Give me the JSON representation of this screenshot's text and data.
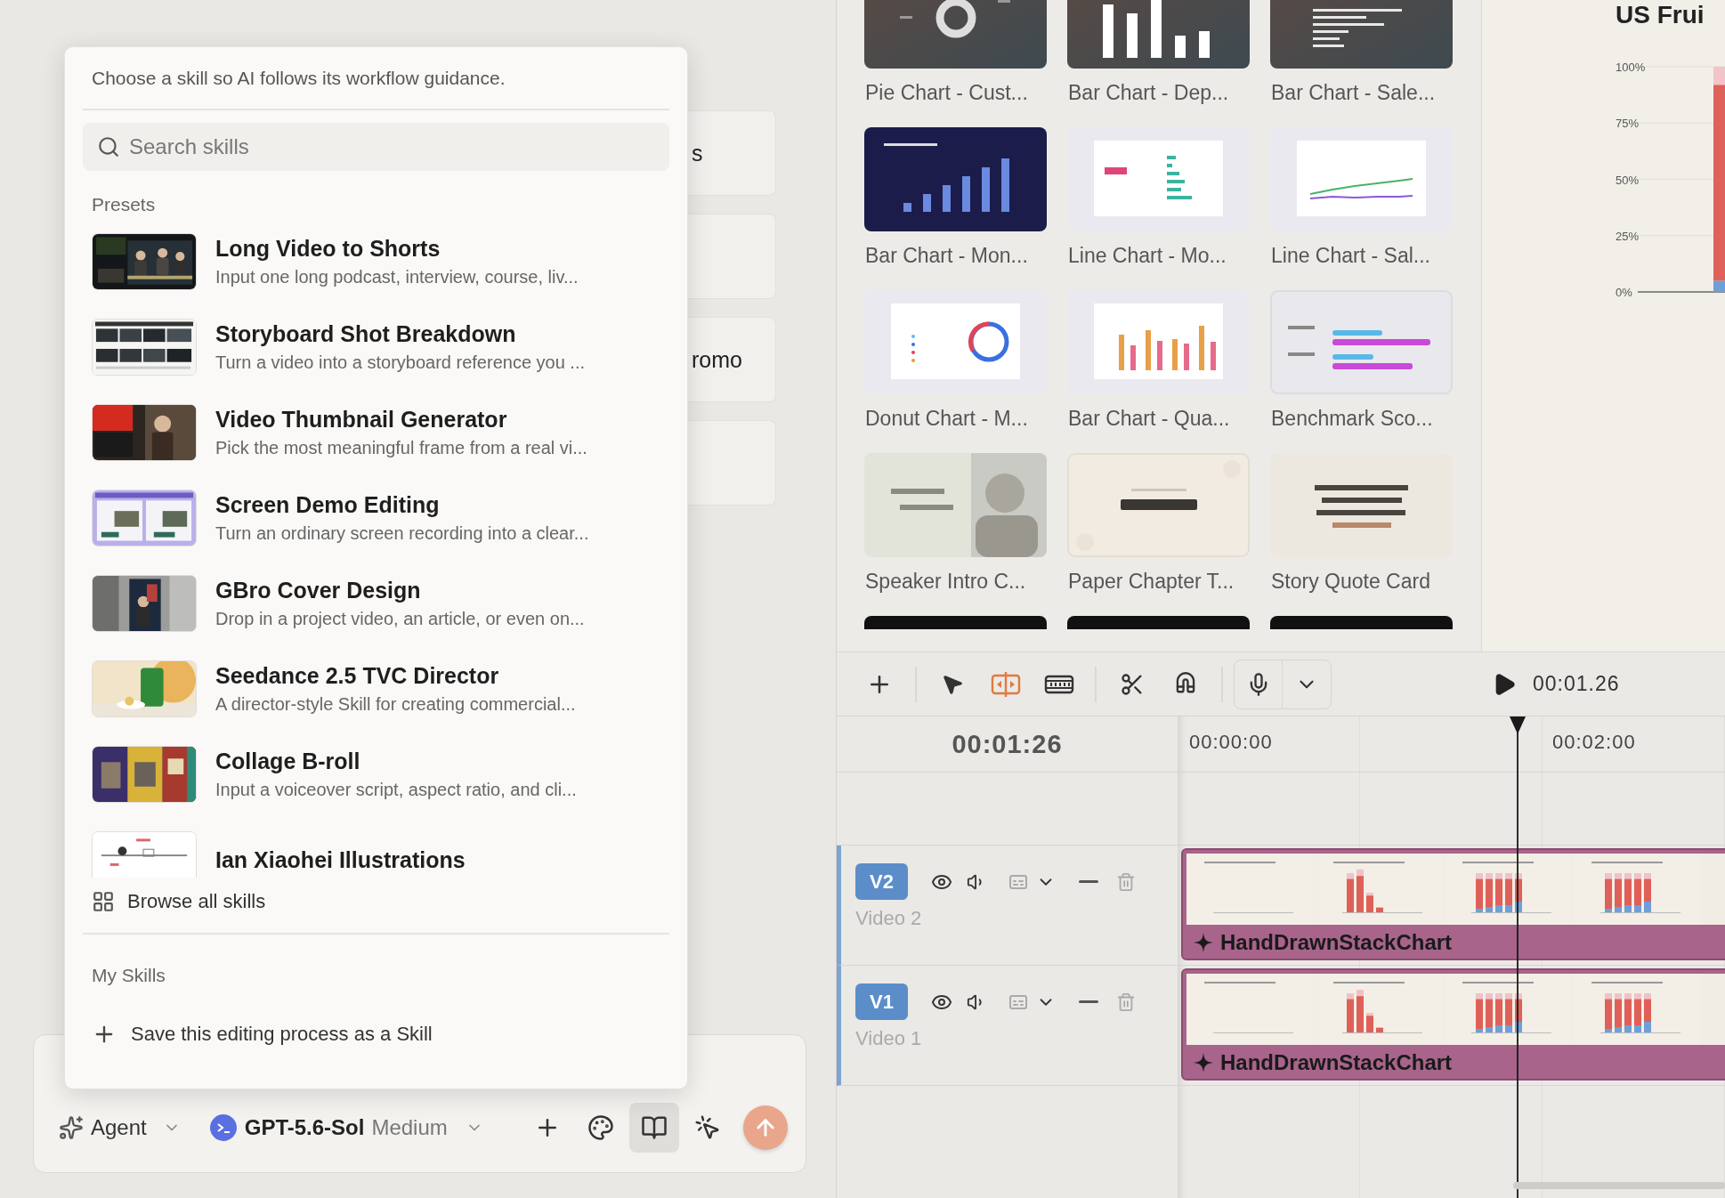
{
  "background_cards": [
    {
      "kind": "text",
      "text": "s"
    },
    {
      "kind": "blank"
    },
    {
      "kind": "text",
      "text": "romo"
    },
    {
      "kind": "blank"
    }
  ],
  "skill_popup": {
    "hint": "Choose a skill so AI follows its workflow guidance.",
    "search": {
      "placeholder": "Search skills"
    },
    "presets_heading": "Presets",
    "presets": [
      {
        "title": "Long Video to Shorts",
        "description": "Input one long podcast, interview, course, liv..."
      },
      {
        "title": "Storyboard Shot Breakdown",
        "description": "Turn a video into a storyboard reference you ..."
      },
      {
        "title": "Video Thumbnail Generator",
        "description": "Pick the most meaningful frame from a real vi..."
      },
      {
        "title": "Screen Demo Editing",
        "description": "Turn an ordinary screen recording into a clear..."
      },
      {
        "title": "GBro Cover Design",
        "description": "Drop in a project video, an article, or even on..."
      },
      {
        "title": "Seedance 2.5 TVC Director",
        "description": "A director-style Skill for creating commercial..."
      },
      {
        "title": "Collage B-roll",
        "description": "Input a voiceover script, aspect ratio, and cli..."
      },
      {
        "title": "Ian Xiaohei Illustrations"
      }
    ],
    "browse_all": "Browse all skills",
    "my_skills_heading": "My Skills",
    "save_action": "Save this editing process as a Skill"
  },
  "composer": {
    "mode": "Agent",
    "model": "GPT-5.6-Sol",
    "effort": "Medium",
    "tools": [
      {
        "kind": "add",
        "selected": false
      },
      {
        "kind": "palette",
        "selected": false
      },
      {
        "kind": "book",
        "selected": true
      },
      {
        "kind": "pointer",
        "selected": false
      }
    ]
  },
  "templates": [
    {
      "kind": "card",
      "title": "Pie Chart - Cust..."
    },
    {
      "kind": "card",
      "title": "Bar Chart - Dep..."
    },
    {
      "kind": "card",
      "title": "Bar Chart - Sale..."
    },
    {
      "kind": "card",
      "title": "Bar Chart - Mon..."
    },
    {
      "kind": "card",
      "title": "Line Chart - Mo..."
    },
    {
      "kind": "card",
      "title": "Line Chart - Sal..."
    },
    {
      "kind": "card",
      "title": "Donut Chart - M..."
    },
    {
      "kind": "card",
      "title": "Bar Chart - Qua..."
    },
    {
      "kind": "card",
      "title": "Benchmark Sco..."
    },
    {
      "kind": "card",
      "title": "Speaker Intro C..."
    },
    {
      "kind": "card",
      "title": "Paper Chapter T..."
    },
    {
      "kind": "card",
      "title": "Story Quote Card"
    },
    {
      "kind": "partial"
    },
    {
      "kind": "partial"
    },
    {
      "kind": "partial"
    }
  ],
  "preview": {
    "chart_data": {
      "type": "bar",
      "title": "US Frui",
      "stacked": true,
      "grid": true,
      "ylim": [
        0,
        100
      ],
      "yticks": [
        {
          "value": 0,
          "label": "0%"
        },
        {
          "value": 25,
          "label": "25%"
        },
        {
          "value": 50,
          "label": "50%"
        },
        {
          "value": 75,
          "label": "75%"
        },
        {
          "value": 100,
          "label": "100%"
        }
      ],
      "series": [
        {
          "color": "#6f9fd8",
          "values": [
            5
          ]
        },
        {
          "color": "#e0605a",
          "values": [
            87
          ]
        },
        {
          "color": "#f2c4c8",
          "values": [
            8
          ]
        }
      ]
    }
  },
  "timeline": {
    "toolbar_groups": [
      [
        {
          "kind": "add",
          "on": false
        }
      ],
      [
        {
          "kind": "select",
          "on": false
        },
        {
          "kind": "split",
          "on": true
        },
        {
          "kind": "ripple",
          "on": false
        }
      ],
      [
        {
          "kind": "cut",
          "on": false
        },
        {
          "kind": "magnet",
          "on": false
        }
      ]
    ],
    "playback_time": "00:01.26",
    "current_time": "00:01:26",
    "ruler": [
      "00:00:00",
      "00:02:00"
    ],
    "tracks": [
      {
        "badge": "V2",
        "name": "Video 2",
        "clip": "HandDrawnStackChart"
      },
      {
        "badge": "V1",
        "name": "Video 1",
        "clip": "HandDrawnStackChart"
      }
    ]
  }
}
